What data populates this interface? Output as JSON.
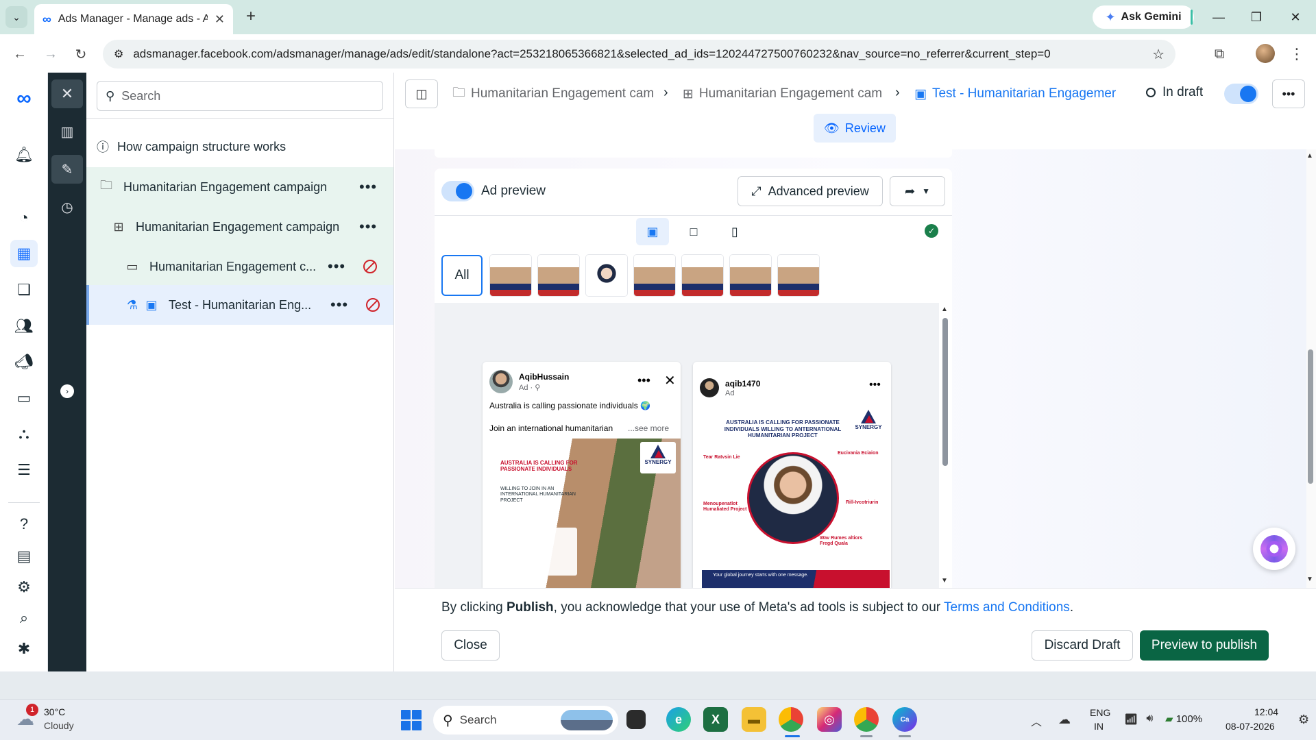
{
  "browser": {
    "tab_title": "Ads Manager - Manage ads - A",
    "ask_gemini": "Ask Gemini",
    "url": "adsmanager.facebook.com/adsmanager/manage/ads/edit/standalone?act=253218065366821&selected_ad_ids=120244727500760232&nav_source=no_referrer&current_step=0"
  },
  "tree": {
    "search_placeholder": "Search",
    "how_it_works": "How campaign structure works",
    "items": [
      {
        "label": "Humanitarian Engagement campaign"
      },
      {
        "label": "Humanitarian Engagement campaign"
      },
      {
        "label": "Humanitarian Engagement c..."
      },
      {
        "label": "Test - Humanitarian Eng..."
      }
    ]
  },
  "header": {
    "crumbs": [
      "Humanitarian Engagement cam",
      "Humanitarian Engagement cam",
      "Test - Humanitarian Engagemer"
    ],
    "status": "In draft",
    "review": "Review"
  },
  "preview": {
    "toggle_label": "Ad preview",
    "advanced": "Advanced preview",
    "all": "All",
    "facebook": {
      "name": "AqibHussain",
      "sub": "Ad · ⚲",
      "text1": "Australia is calling passionate individuals 🌍",
      "text2": "Join an international humanitarian",
      "see_more": "...see more",
      "headline": "AUSTRALIA IS CALLING FOR PASSIONATE INDIVIDUALS",
      "subheadline": "WILLING TO JOIN IN AN INTERNATIONAL HUMANITARIAN PROJECT",
      "logo": "SYNERGY"
    },
    "instagram": {
      "name": "aqib1470",
      "sub": "Ad",
      "headline": "AUSTRALIA IS CALLING FOR PASSIONATE INDIVIDUALS WILLING TO ANTERNATIONAL HUMANITARIAN PROJECT",
      "logo": "SYNERGY",
      "note1_title": "Tear Ratvsin Lie",
      "note2_title": "Eucivania Eciaion",
      "note3_title": "Menoupenatlot Humaliated Project",
      "note4_title": "Rill-Ivcotriurin",
      "note5_title": "Wav Rumes altiors Fregd Quala",
      "band": "Your global journey starts with one message."
    }
  },
  "publish": {
    "note_pre": "By clicking ",
    "note_bold": "Publish",
    "note_mid": ", you acknowledge that your use of Meta's ad tools is subject to our ",
    "note_link": "Terms and Conditions",
    "note_end": ".",
    "close": "Close",
    "discard": "Discard Draft",
    "preview_publish": "Preview to publish"
  },
  "taskbar": {
    "weather_badge": "1",
    "temp": "30°C",
    "condition": "Cloudy",
    "search": "Search",
    "lang1": "ENG",
    "lang2": "IN",
    "battery": "100%",
    "time": "12:04",
    "date": "08-07-2026"
  },
  "colors": {
    "accent": "#1877f2",
    "publish": "#0a6544",
    "tab_strip": "#d3e9e4",
    "dark_rail": "#1c2b33"
  }
}
